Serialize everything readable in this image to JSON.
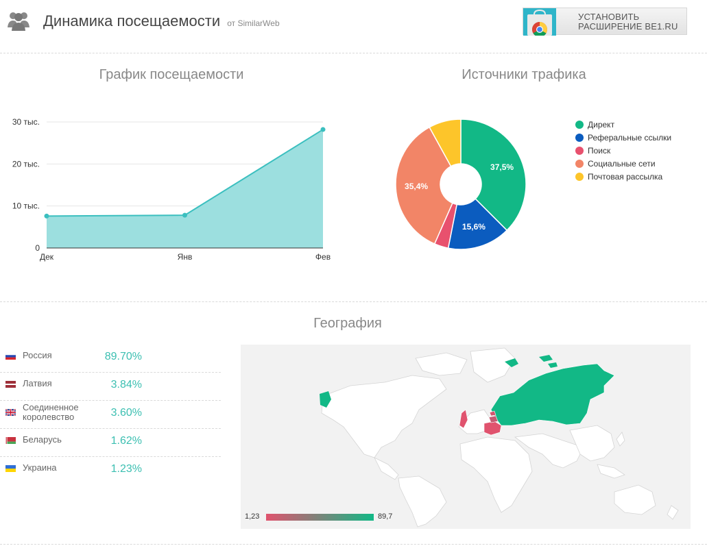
{
  "header": {
    "title": "Динамика посещаемости",
    "source": "от SimilarWeb",
    "extension_button": {
      "line1": "УСТАНОВИТЬ",
      "line2": "РАСШИРЕНИЕ BE1.RU"
    },
    "icon": "users-icon"
  },
  "traffic": {
    "title": "График посещаемости",
    "y_tick_labels": [
      "0",
      "10 тыс.",
      "20 тыс.",
      "30 тыс."
    ],
    "x_tick_labels": [
      "Дек",
      "Янв",
      "Фев"
    ]
  },
  "sources": {
    "title": "Источники трафика",
    "legend": [
      "Директ",
      "Реферальные ссылки",
      "Поиск",
      "Социальные сети",
      "Почтовая рассылка"
    ],
    "slice_labels": [
      "37,5%",
      "15,6%",
      "35,4%"
    ]
  },
  "geography": {
    "title": "География",
    "countries": [
      {
        "name": "Россия",
        "pct": "89.70%",
        "flag": "flag-russia"
      },
      {
        "name": "Латвия",
        "pct": "3.84%",
        "flag": "flag-latvia"
      },
      {
        "name": "Соединенное королевство",
        "pct": "3.60%",
        "flag": "flag-uk"
      },
      {
        "name": "Беларусь",
        "pct": "1.62%",
        "flag": "flag-belarus"
      },
      {
        "name": "Украина",
        "pct": "1.23%",
        "flag": "flag-ukraine"
      }
    ],
    "scale_min": "1,23",
    "scale_max": "89,7",
    "colors": {
      "low": "#e0536e",
      "high": "#12b886"
    }
  },
  "chart_data": [
    {
      "type": "area",
      "title": "График посещаемости",
      "categories": [
        "Дек",
        "Янв",
        "Фев"
      ],
      "values": [
        7600,
        7800,
        28200
      ],
      "ylim": [
        0,
        30000
      ],
      "y_ticks": [
        0,
        10000,
        20000,
        30000
      ],
      "grid": true,
      "color": "#3bbfbf",
      "fill": "#9cdfdf"
    },
    {
      "type": "pie",
      "title": "Источники трафика",
      "donut": true,
      "legend_position": "right",
      "slices": [
        {
          "label": "Директ",
          "value": 37.5,
          "color": "#12b886"
        },
        {
          "label": "Реферальные ссылки",
          "value": 15.6,
          "color": "#0b5cbf"
        },
        {
          "label": "Поиск",
          "value": 3.5,
          "color": "#e8516e"
        },
        {
          "label": "Социальные сети",
          "value": 35.4,
          "color": "#f28567"
        },
        {
          "label": "Почтовая рассылка",
          "value": 8.0,
          "color": "#fdc52a"
        }
      ]
    }
  ]
}
